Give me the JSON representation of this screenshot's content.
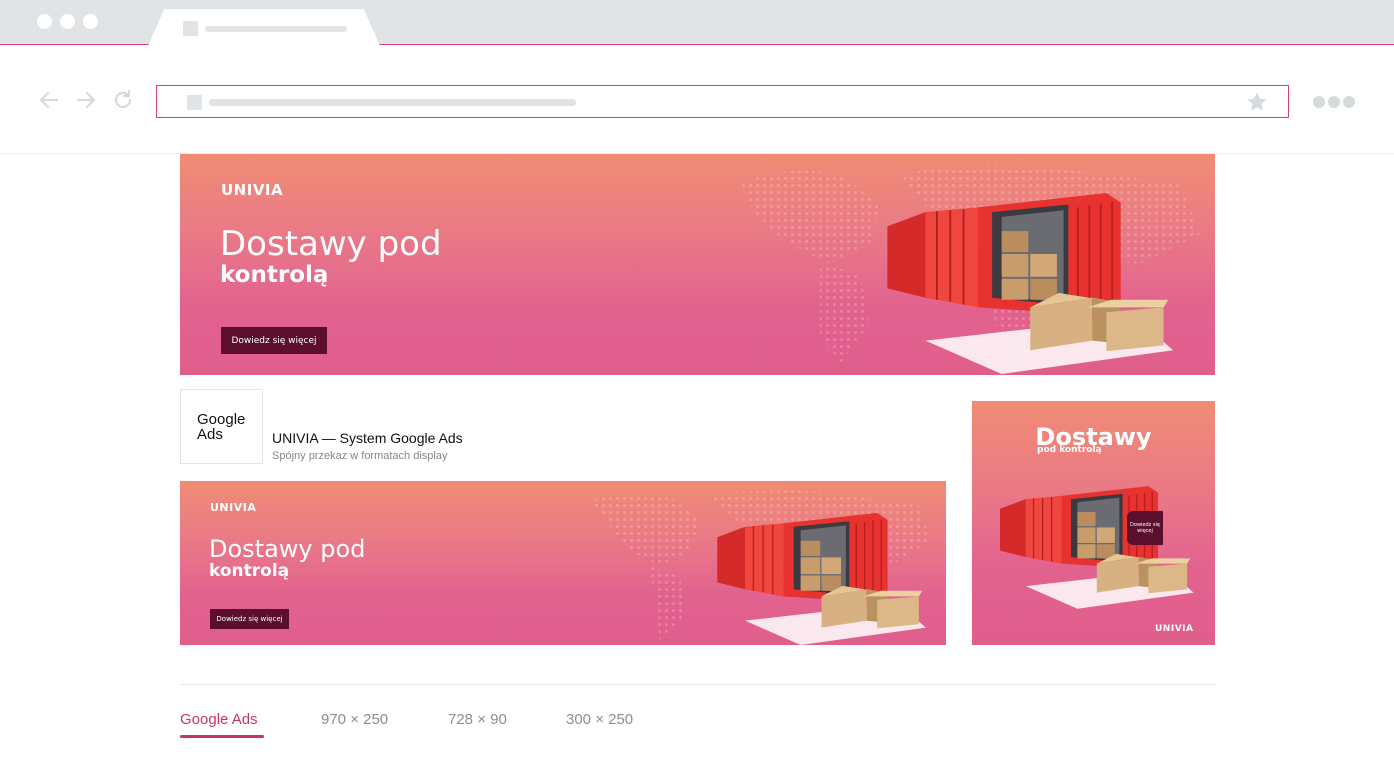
{
  "colors": {
    "accent": "#d1426f",
    "chrome_gray": "#e0e4e7",
    "cta_dark": "#5c0f2c",
    "banner_top": "#f08c74",
    "banner_bottom": "#e05e8c",
    "tab_active": "#c8336a"
  },
  "browser": {
    "icons": [
      "back-arrow-icon",
      "forward-arrow-icon",
      "reload-icon",
      "star-icon",
      "more-dots-icon"
    ]
  },
  "banners": {
    "large": {
      "brand": "UNIVIA",
      "headline_line1": "Dostawy pod",
      "headline_line2": "kontrolą",
      "cta": "Dowiedz się więcej"
    },
    "leaderboard": {
      "brand": "UNIVIA",
      "headline_line1": "Dostawy pod",
      "headline_line2": "kontrolą",
      "cta": "Dowiedz się więcej"
    },
    "square": {
      "headline_line1": "Dostawy",
      "headline_line2": "pod kontrolą",
      "cta": "Dowiedz się więcej",
      "brand": "UNIVIA"
    }
  },
  "ad_card": {
    "logo_line1": "Google",
    "logo_line2": "Ads",
    "title": "UNIVIA — System Google Ads",
    "subtitle": "Spójny przekaz w formatach display"
  },
  "format_tabs": [
    {
      "label": "Google Ads",
      "active": true
    },
    {
      "label": "970 × 250",
      "active": false
    },
    {
      "label": "728 × 90",
      "active": false
    },
    {
      "label": "300 × 250",
      "active": false
    }
  ]
}
